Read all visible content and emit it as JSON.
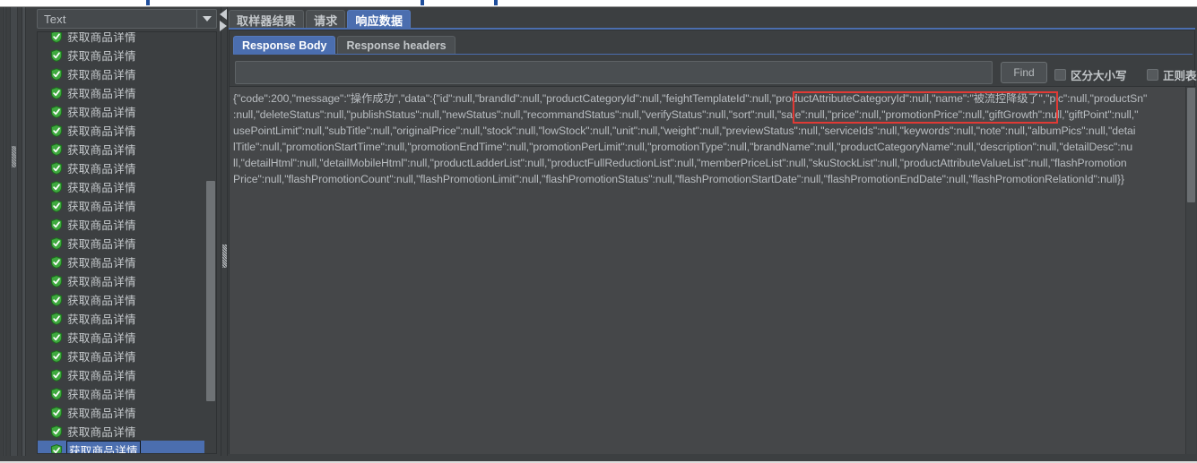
{
  "window": {
    "theme_bg": "#3c3f41",
    "accent": "#4b6eaf",
    "annotation_color": "#e03a35"
  },
  "left_pane": {
    "combo": {
      "name": "render-type-combo",
      "value": "Text",
      "arrow_icon": "chevron-down-icon"
    },
    "tree": {
      "item_icon": "green-shield-check-icon",
      "items": [
        {
          "label": "获取商品详情",
          "selected": false
        },
        {
          "label": "获取商品详情",
          "selected": false
        },
        {
          "label": "获取商品详情",
          "selected": false
        },
        {
          "label": "获取商品详情",
          "selected": false
        },
        {
          "label": "获取商品详情",
          "selected": false
        },
        {
          "label": "获取商品详情",
          "selected": false
        },
        {
          "label": "获取商品详情",
          "selected": false
        },
        {
          "label": "获取商品详情",
          "selected": false
        },
        {
          "label": "获取商品详情",
          "selected": false
        },
        {
          "label": "获取商品详情",
          "selected": false
        },
        {
          "label": "获取商品详情",
          "selected": false
        },
        {
          "label": "获取商品详情",
          "selected": false
        },
        {
          "label": "获取商品详情",
          "selected": false
        },
        {
          "label": "获取商品详情",
          "selected": false
        },
        {
          "label": "获取商品详情",
          "selected": false
        },
        {
          "label": "获取商品详情",
          "selected": false
        },
        {
          "label": "获取商品详情",
          "selected": false
        },
        {
          "label": "获取商品详情",
          "selected": false
        },
        {
          "label": "获取商品详情",
          "selected": false
        },
        {
          "label": "获取商品详情",
          "selected": false
        },
        {
          "label": "获取商品详情",
          "selected": false
        },
        {
          "label": "获取商品详情",
          "selected": false
        },
        {
          "label": "获取商品详情",
          "selected": true
        }
      ]
    }
  },
  "right_pane": {
    "main_tabs": [
      {
        "label": "取样器结果",
        "active": false
      },
      {
        "label": "请求",
        "active": false
      },
      {
        "label": "响应数据",
        "active": true
      }
    ],
    "sub_tabs": [
      {
        "label": "Response Body",
        "active": true
      },
      {
        "label": "Response headers",
        "active": false
      }
    ],
    "find_bar": {
      "input_value": "",
      "input_placeholder": "",
      "find_button": "Find",
      "checkboxes": [
        {
          "label": "区分大小写",
          "checked": false
        },
        {
          "label": "正则表达式",
          "checked": false
        }
      ]
    },
    "response_body": {
      "lines": [
        "{\"code\":200,\"message\":\"操作成功\",\"data\":{\"id\":null,\"brandId\":null,\"productCategoryId\":null,\"feightTemplateId\":null,\"productAttributeCategoryId\":null,\"name\":\"被流控降级了\",\"pic\":null,\"productSn\"",
        ":null,\"deleteStatus\":null,\"publishStatus\":null,\"newStatus\":null,\"recommandStatus\":null,\"verifyStatus\":null,\"sort\":null,\"sale\":null,\"price\":null,\"promotionPrice\":null,\"giftGrowth\":null,\"giftPoint\":null,\"",
        "usePointLimit\":null,\"subTitle\":null,\"originalPrice\":null,\"stock\":null,\"lowStock\":null,\"unit\":null,\"weight\":null,\"previewStatus\":null,\"serviceIds\":null,\"keywords\":null,\"note\":null,\"albumPics\":null,\"detai",
        "lTitle\":null,\"promotionStartTime\":null,\"promotionEndTime\":null,\"promotionPerLimit\":null,\"promotionType\":null,\"brandName\":null,\"productCategoryName\":null,\"description\":null,\"detailDesc\":nu",
        "ll,\"detailHtml\":null,\"detailMobileHtml\":null,\"productLadderList\":null,\"productFullReductionList\":null,\"memberPriceList\":null,\"skuStockList\":null,\"productAttributeValueList\":null,\"flashPromotion",
        "Price\":null,\"flashPromotionCount\":null,\"flashPromotionLimit\":null,\"flashPromotionStatus\":null,\"flashPromotionStartDate\":null,\"flashPromotionEndDate\":null,\"flashPromotionRelationId\":null}}"
      ]
    },
    "annotation": {
      "name": "red-highlight-box",
      "covers": "\"productAttributeCategoryId\":null,\"name\":\"被流控降级了\""
    }
  }
}
